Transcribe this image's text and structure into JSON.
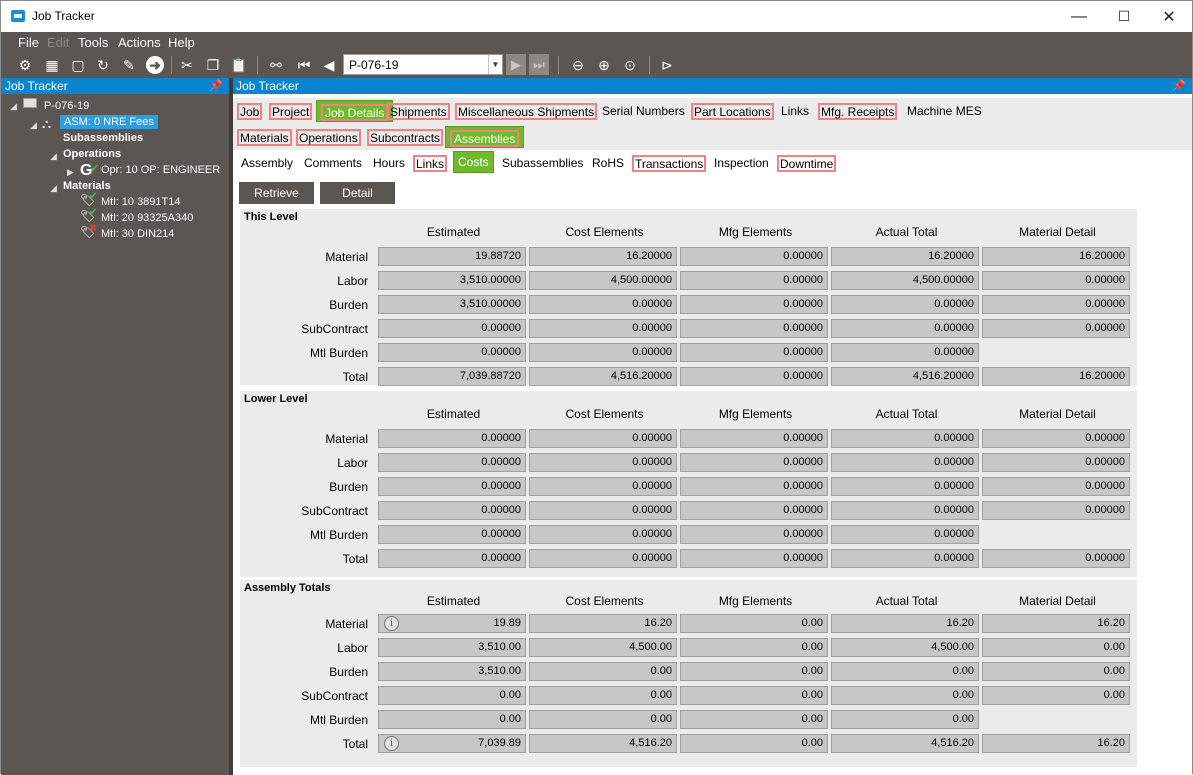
{
  "window": {
    "title": "Job Tracker",
    "minimize": "—",
    "maximize": "☐",
    "close": "✕"
  },
  "menu": [
    "File",
    "Edit",
    "Tools",
    "Actions",
    "Help"
  ],
  "toolbar": {
    "job_value": "P-076-19",
    "icons": [
      "sewing-machine-icon",
      "grid-icon",
      "note-icon",
      "refresh-icon",
      "broom-icon",
      "arrow-right-icon",
      "cut-icon",
      "copy-icon",
      "paste-icon",
      "binoculars-icon",
      "first-icon",
      "prev-icon",
      "next-icon",
      "last-icon",
      "back-icon",
      "forward-icon",
      "home-icon",
      "play-icon"
    ]
  },
  "left_panel": {
    "title": "Job Tracker",
    "tree": [
      {
        "label": "P-076-19"
      },
      {
        "label": "ASM: 0 NRE Fees"
      },
      {
        "label": "Subassemblies"
      },
      {
        "label": "Operations"
      },
      {
        "label": "Opr: 10 OP: ENGINEER"
      },
      {
        "label": "Materials"
      },
      {
        "label": "Mtl: 10 3891T14"
      },
      {
        "label": "Mtl: 20 93325A340"
      },
      {
        "label": "Mtl: 30 DIN214"
      }
    ]
  },
  "right_panel": {
    "title": "Job Tracker"
  },
  "tabs1": [
    "Job",
    "Project",
    "Job Details",
    "Shipments",
    "Miscellaneous Shipments",
    "Serial Numbers",
    "Part Locations",
    "Links",
    "Mfg. Receipts",
    "Machine MES"
  ],
  "tabs2": [
    "Materials",
    "Operations",
    "Subcontracts",
    "Assemblies"
  ],
  "tabs3": [
    "Assembly",
    "Comments",
    "Hours",
    "Links",
    "Costs",
    "Subassemblies",
    "RoHS",
    "Transactions",
    "Inspection",
    "Downtime"
  ],
  "buttons": {
    "retrieve": "Retrieve",
    "detail": "Detail"
  },
  "columns": [
    "Estimated",
    "Cost Elements",
    "Mfg Elements",
    "Actual Total",
    "Material Detail"
  ],
  "rows": [
    "Material",
    "Labor",
    "Burden",
    "SubContract",
    "Mtl Burden",
    "Total"
  ],
  "this_level": {
    "title": "This Level",
    "values": [
      [
        "19.88720",
        "16.20000",
        "0.00000",
        "16.20000",
        "16.20000"
      ],
      [
        "3,510.00000",
        "4,500.00000",
        "0.00000",
        "4,500.00000",
        "0.00000"
      ],
      [
        "3,510.00000",
        "0.00000",
        "0.00000",
        "0.00000",
        "0.00000"
      ],
      [
        "0.00000",
        "0.00000",
        "0.00000",
        "0.00000",
        "0.00000"
      ],
      [
        "0.00000",
        "0.00000",
        "0.00000",
        "0.00000",
        null
      ],
      [
        "7,039.88720",
        "4,516.20000",
        "0.00000",
        "4,516.20000",
        "16.20000"
      ]
    ]
  },
  "lower_level": {
    "title": "Lower Level",
    "values": [
      [
        "0.00000",
        "0.00000",
        "0.00000",
        "0.00000",
        "0.00000"
      ],
      [
        "0.00000",
        "0.00000",
        "0.00000",
        "0.00000",
        "0.00000"
      ],
      [
        "0.00000",
        "0.00000",
        "0.00000",
        "0.00000",
        "0.00000"
      ],
      [
        "0.00000",
        "0.00000",
        "0.00000",
        "0.00000",
        "0.00000"
      ],
      [
        "0.00000",
        "0.00000",
        "0.00000",
        "0.00000",
        null
      ],
      [
        "0.00000",
        "0.00000",
        "0.00000",
        "0.00000",
        "0.00000"
      ]
    ]
  },
  "assembly_totals": {
    "title": "Assembly Totals",
    "values": [
      [
        "19.89",
        "16.20",
        "0.00",
        "16.20",
        "16.20"
      ],
      [
        "3,510.00",
        "4,500.00",
        "0.00",
        "4,500.00",
        "0.00"
      ],
      [
        "3,510.00",
        "0.00",
        "0.00",
        "0.00",
        "0.00"
      ],
      [
        "0.00",
        "0.00",
        "0.00",
        "0.00",
        "0.00"
      ],
      [
        "0.00",
        "0.00",
        "0.00",
        "0.00",
        null
      ],
      [
        "7,039.89",
        "4,516.20",
        "0.00",
        "4,516.20",
        "16.20"
      ]
    ]
  }
}
